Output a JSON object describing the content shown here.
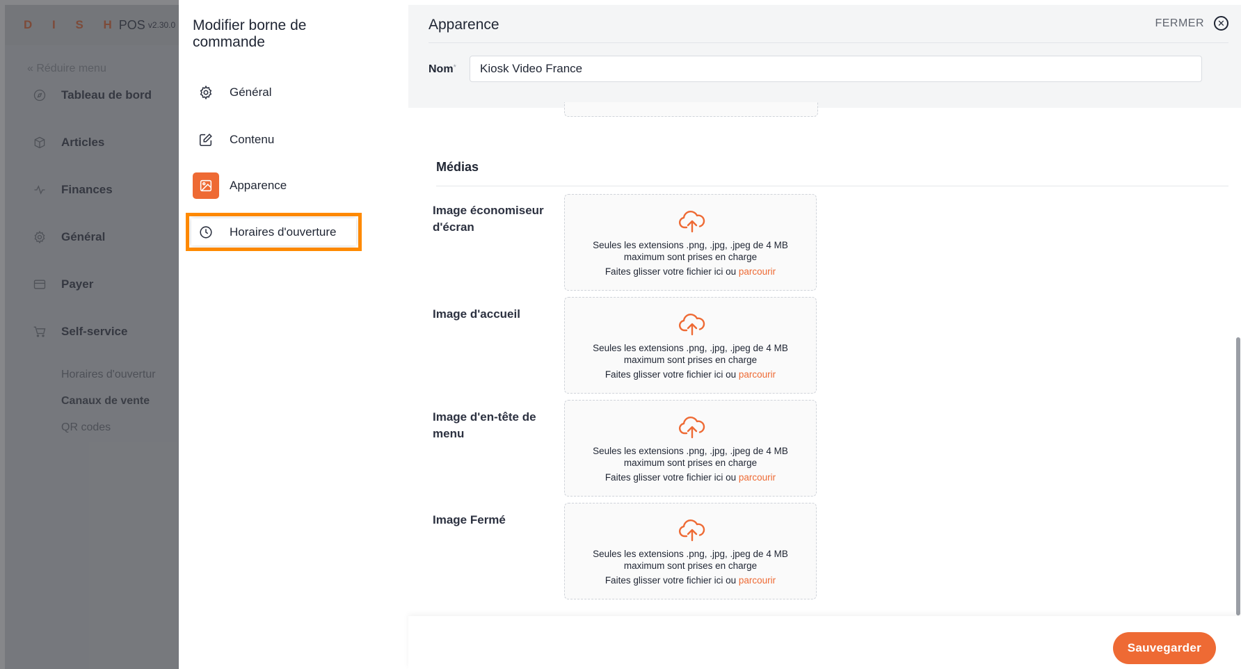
{
  "app": {
    "brand_letters": "D I S H",
    "brand_name": "POS",
    "version": "v2.30.0",
    "reduce_menu": "« Réduire menu",
    "nav": [
      {
        "label": "Tableau de bord",
        "icon": "dashboard-icon"
      },
      {
        "label": "Articles",
        "icon": "box-icon"
      },
      {
        "label": "Finances",
        "icon": "activity-icon"
      },
      {
        "label": "Général",
        "icon": "gear-icon"
      },
      {
        "label": "Payer",
        "icon": "credit-card-icon"
      },
      {
        "label": "Self-service",
        "icon": "cart-icon"
      }
    ],
    "subnav": [
      "Horaires d'ouvertur",
      "Canaux de vente",
      "QR codes"
    ]
  },
  "modal_menu": {
    "title": "Modifier borne de commande",
    "items": [
      {
        "label": "Général",
        "icon": "gear-icon"
      },
      {
        "label": "Contenu",
        "icon": "edit-icon"
      },
      {
        "label": "Apparence",
        "icon": "image-icon",
        "active": true
      },
      {
        "label": "Horaires d'ouverture",
        "icon": "clock-icon",
        "highlighted": true
      }
    ]
  },
  "main": {
    "title": "Apparence",
    "close_label": "FERMER",
    "name_label": "Nom",
    "name_required_mark": "*",
    "name_value": "Kiosk Video France",
    "media_section_title": "Médias",
    "media_fields": [
      {
        "label": "Image économiseur d'écran"
      },
      {
        "label": "Image d'accueil"
      },
      {
        "label": "Image d'en-tête de menu"
      },
      {
        "label": "Image Fermé"
      }
    ],
    "upload_hint": "Seules les extensions .png, .jpg, .jpeg de 4 MB maximum sont prises en charge",
    "upload_drag_text": "Faites glisser votre fichier ici ou",
    "upload_browse_text": "parcourir",
    "save_label": "Sauvegarder"
  },
  "colors": {
    "accent": "#ee6a34",
    "highlight": "#ff8a00"
  }
}
